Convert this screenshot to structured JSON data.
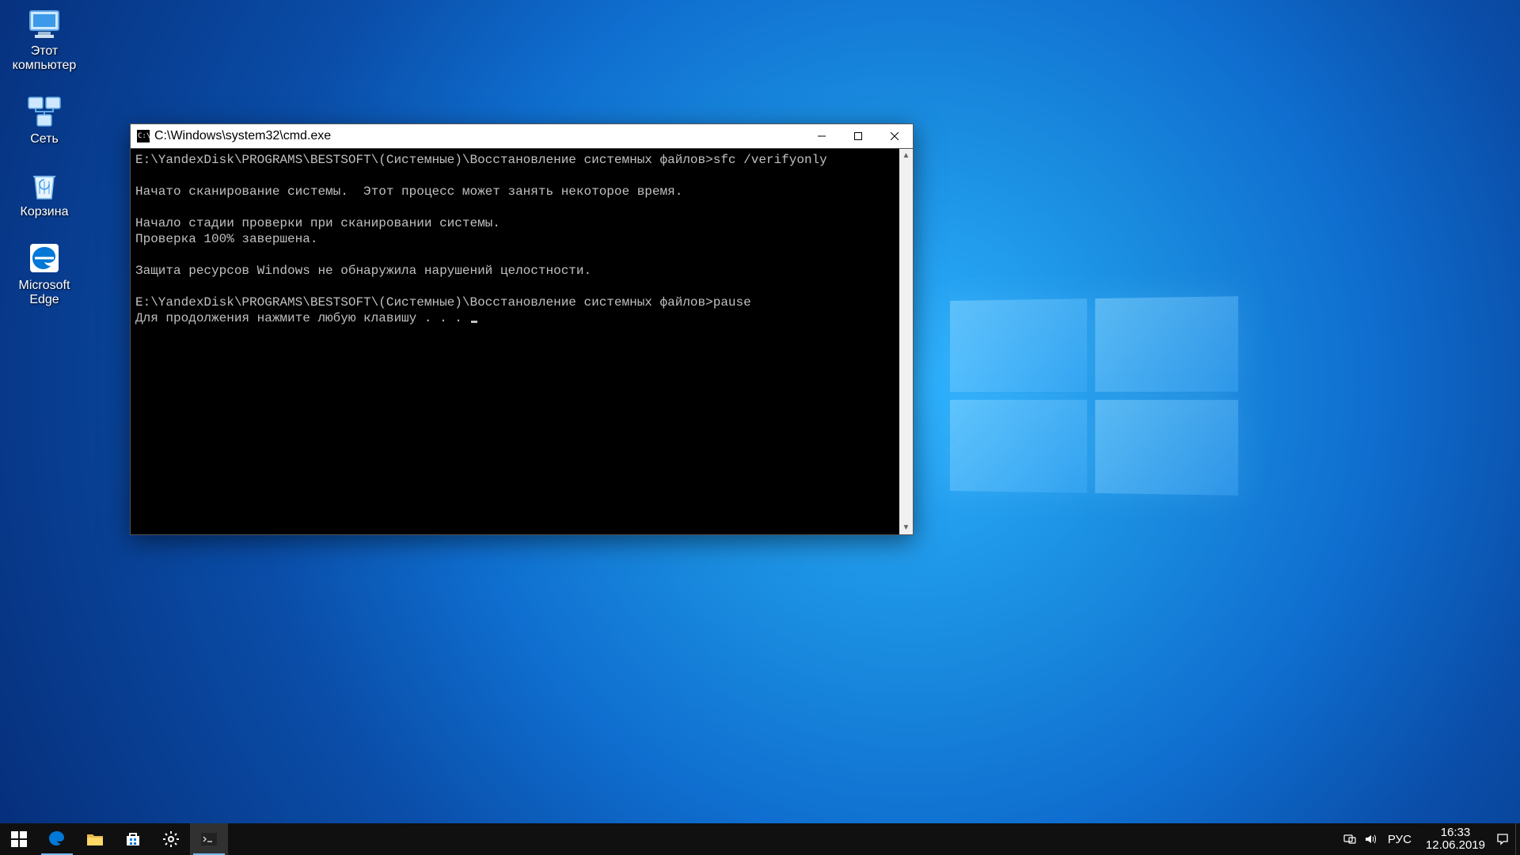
{
  "desktop_icons": {
    "computer": "Этот\nкомпьютер",
    "network": "Сеть",
    "recycle": "Корзина",
    "edge": "Microsoft\nEdge"
  },
  "cmd": {
    "title": "C:\\Windows\\system32\\cmd.exe",
    "lines": {
      "l1": "E:\\YandexDisk\\PROGRAMS\\BESTSOFT\\(Системные)\\Восстановление системных файлов>sfc /verifyonly",
      "l2": "",
      "l3": "Начато сканирование системы.  Этот процесс может занять некоторое время.",
      "l4": "",
      "l5": "Начало стадии проверки при сканировании системы.",
      "l6": "Проверка 100% завершена.",
      "l7": "",
      "l8": "Защита ресурсов Windows не обнаружила нарушений целостности.",
      "l9": "",
      "l10": "E:\\YandexDisk\\PROGRAMS\\BESTSOFT\\(Системные)\\Восстановление системных файлов>pause",
      "l11": "Для продолжения нажмите любую клавишу . . . "
    }
  },
  "tray": {
    "lang": "РУС",
    "time": "16:33",
    "date": "12.06.2019"
  }
}
